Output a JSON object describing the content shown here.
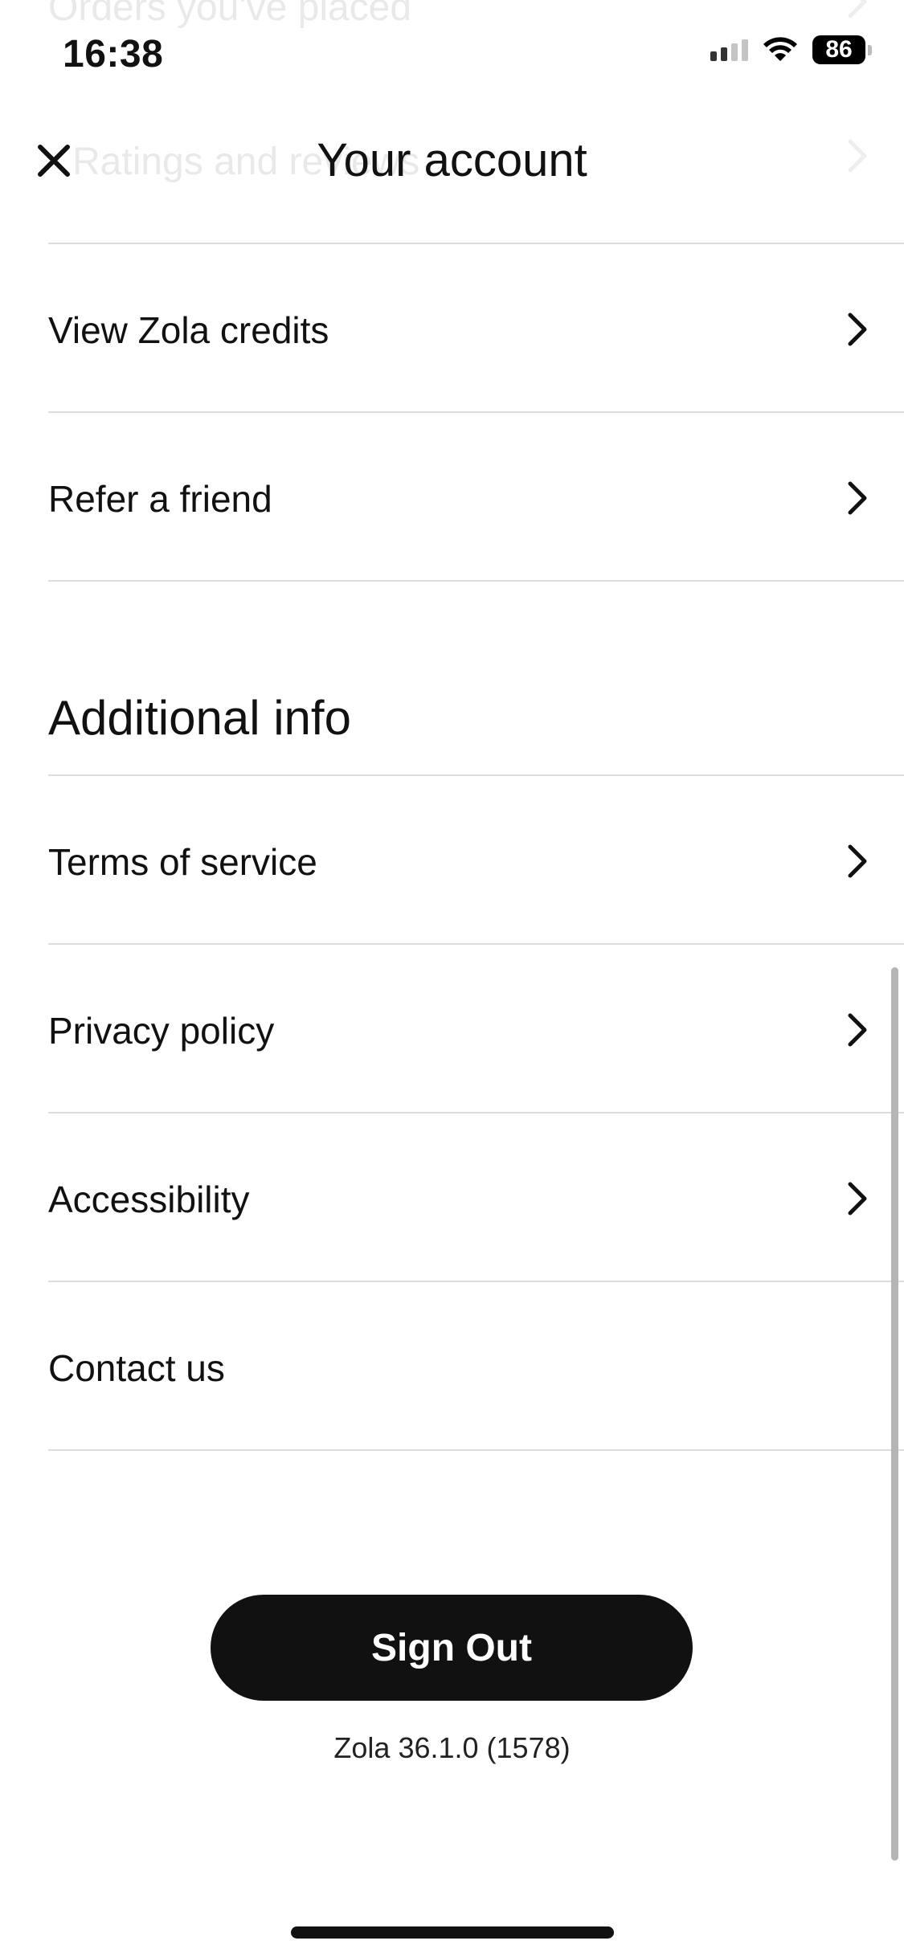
{
  "status_bar": {
    "time": "16:38",
    "battery": "86",
    "icons": [
      "cellular-signal-icon",
      "wifi-icon",
      "battery-icon"
    ]
  },
  "header": {
    "title": "Your account",
    "background_partial_rows": [
      "Orders you've placed",
      "Ratings and reviews"
    ],
    "close_icon": "close-icon"
  },
  "account_items": [
    {
      "label": "View Zola credits",
      "icon": "chevron-right-icon"
    },
    {
      "label": "Refer a friend",
      "icon": "chevron-right-icon"
    }
  ],
  "additional_info": {
    "heading": "Additional info",
    "items": [
      {
        "label": "Terms of service",
        "icon": "chevron-right-icon"
      },
      {
        "label": "Privacy policy",
        "icon": "chevron-right-icon"
      },
      {
        "label": "Accessibility",
        "icon": "chevron-right-icon"
      },
      {
        "label": "Contact us"
      }
    ]
  },
  "sign_out_label": "Sign Out",
  "version": "Zola 36.1.0 (1578)",
  "colors": {
    "text": "#111111",
    "divider": "#dcdcdc",
    "button_bg": "#111111",
    "button_text": "#ffffff",
    "background": "#ffffff"
  }
}
